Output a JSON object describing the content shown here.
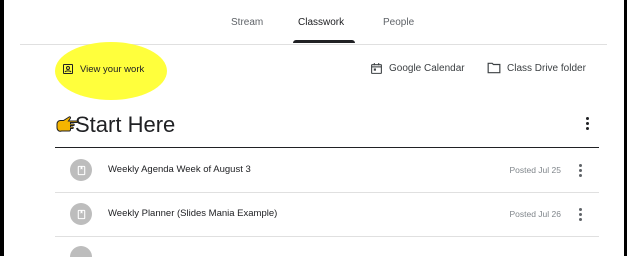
{
  "tabs": [
    {
      "label": "Stream",
      "active": false
    },
    {
      "label": "Classwork",
      "active": true
    },
    {
      "label": "People",
      "active": false
    }
  ],
  "actions": {
    "view_work_label": "View your work",
    "calendar_label": "Google Calendar",
    "drive_label": "Class Drive folder"
  },
  "section": {
    "title": "Start Here",
    "icon": "pointing-hand-icon"
  },
  "items": [
    {
      "title": "Weekly Agenda Week of August 3",
      "posted": "Posted Jul 25",
      "icon": "material-icon"
    },
    {
      "title": "Weekly Planner (Slides Mania Example)",
      "posted": "Posted Jul 26",
      "icon": "material-icon"
    }
  ],
  "colors": {
    "highlight": "#ffff3c",
    "badge": "#bdbdbd",
    "text": "#202124",
    "muted": "#80868b"
  }
}
